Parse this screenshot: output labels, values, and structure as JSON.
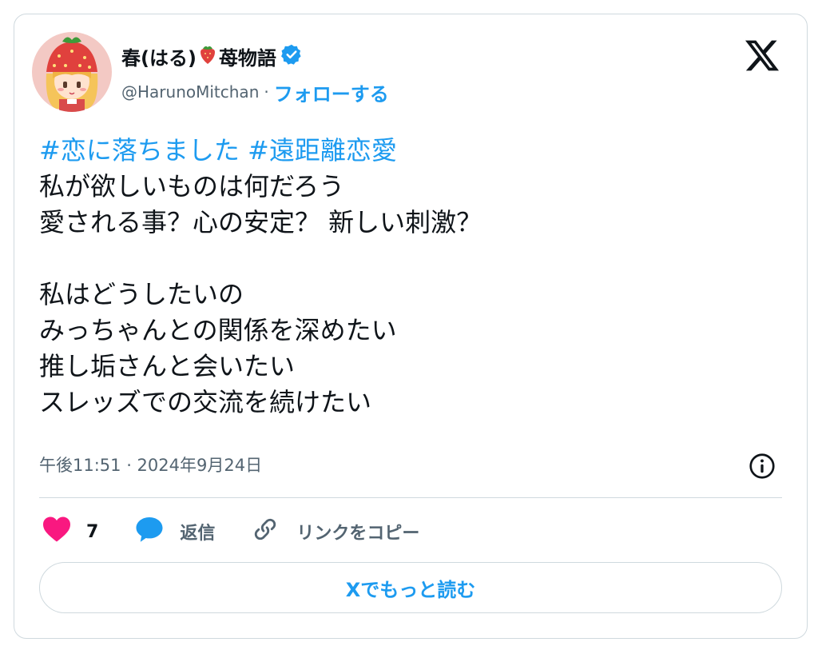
{
  "user": {
    "display_name": "春(はる)",
    "display_name_suffix": "苺物語",
    "handle": "@HarunoMitchan",
    "separator": "·",
    "follow_label": "フォローする",
    "avatar_icon": "strawberry-hat-girl-avatar",
    "badge_icon": "verified-badge-icon"
  },
  "tweet": {
    "hashtags": [
      "#恋に落ちました",
      "#遠距離恋愛"
    ],
    "lines": [
      "私が欲しいものは何だろう",
      "愛される事？心の安定？ 新しい刺激？",
      "",
      "私はどうしたいの",
      "みっちゃんとの関係を深めたい",
      "推し垢さんと会いたい",
      "スレッズでの交流を続けたい"
    ],
    "timestamp": "午後11:51 · 2024年9月24日"
  },
  "actions": {
    "like_count": "7",
    "reply_label": "返信",
    "copy_link_label": "リンクをコピー"
  },
  "read_more_label": "Xでもっと読む",
  "colors": {
    "accent": "#1d9bf0",
    "like": "#f91880",
    "text": "#0f1419",
    "secondary": "#536471",
    "border": "#cfd9de"
  }
}
